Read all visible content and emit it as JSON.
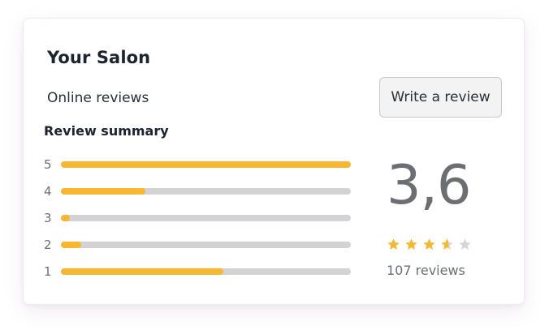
{
  "card": {
    "title": "Your Salon",
    "subtitle": "Online reviews",
    "write_review_label": "Write a review",
    "summary_label": "Review summary"
  },
  "distribution": [
    {
      "stars": "5",
      "fraction": 1.0
    },
    {
      "stars": "4",
      "fraction": 0.29
    },
    {
      "stars": "3",
      "fraction": 0.03
    },
    {
      "stars": "2",
      "fraction": 0.07
    },
    {
      "stars": "1",
      "fraction": 0.56
    }
  ],
  "rating": {
    "value": "3,6",
    "stars_filled": 3.6,
    "stars_total": 5,
    "count_text": "107 reviews"
  },
  "colors": {
    "accent": "#f7b731",
    "track": "#d3d3d5",
    "star_empty": "#d6d6d8"
  },
  "icons": {
    "star": "star-icon"
  }
}
